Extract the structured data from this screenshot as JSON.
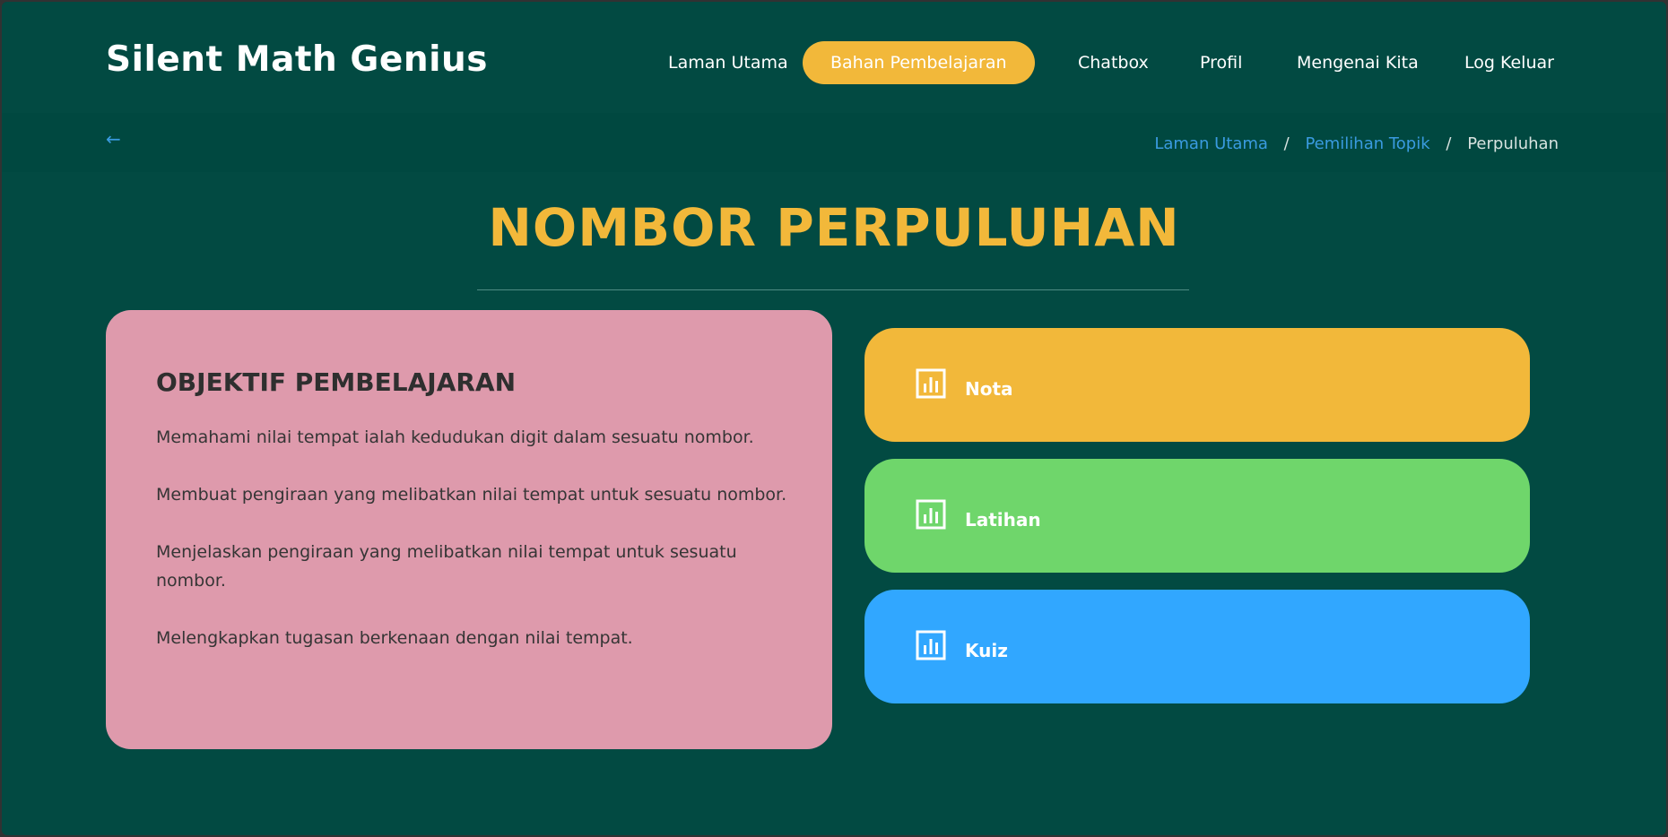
{
  "brand": {
    "title": "Silent Math Genius"
  },
  "nav": {
    "items": [
      {
        "label": "Laman Utama"
      },
      {
        "label": "Bahan Pembelajaran",
        "active": true
      },
      {
        "label": "Chatbox"
      },
      {
        "label": "Profil"
      },
      {
        "label": "Mengenai Kita"
      },
      {
        "label": "Log Keluar"
      }
    ]
  },
  "breadcrumb": {
    "back_icon": "arrow-left-icon",
    "items": [
      {
        "label": "Laman Utama"
      },
      {
        "label": "Pemilihan Topik"
      },
      {
        "label": "Perpuluhan"
      }
    ],
    "separator": "/"
  },
  "page": {
    "title": "NOMBOR PERPULUHAN"
  },
  "objectives": {
    "heading": "OBJEKTIF PEMBELAJARAN",
    "items": [
      "Memahami nilai tempat ialah kedudukan digit dalam sesuatu nombor.",
      "Membuat pengiraan yang melibatkan nilai tempat untuk sesuatu nombor.",
      "Menjelaskan pengiraan yang melibatkan nilai tempat untuk sesuatu nombor.",
      "Melengkapkan tugasan berkenaan dengan nilai tempat."
    ]
  },
  "topics": [
    {
      "label": "Nota",
      "icon": "bar-chart-icon",
      "color": "#f2b83a"
    },
    {
      "label": "Latihan",
      "icon": "bar-chart-icon",
      "color": "#6fd66b"
    },
    {
      "label": "Kuiz",
      "icon": "bar-chart-icon",
      "color": "#31a7ff"
    }
  ],
  "colors": {
    "background": "#024a42",
    "accent": "#f2b83a",
    "link": "#3a9be0",
    "objectives_card": "#de9aac"
  }
}
